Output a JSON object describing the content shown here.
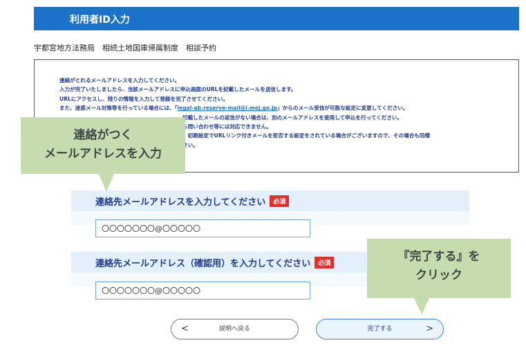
{
  "header": {
    "title": "利用者ID入力"
  },
  "breadcrumb": "宇都宮地方法務局　相続土地国庫帰属制度　相談予約",
  "notice": {
    "line1": "連絡がとれるメールアドレスを入力してください。",
    "line2": "入力が完了いたしましたら、当該メールアドレスに申込画面のURLを記載したメールを送信します。",
    "line3": "URLにアクセスし、残りの情報を入力して登録を完了させてください。",
    "line4_prefix": "また、迷惑メール対策等を行っている場合には、「",
    "line4_link": "legal-ab.reserve-mail@i.moj.go.jp",
    "line4_suffix": "」からのメール受信が可能な設定に変更してください。",
    "line5": "記載したメールの返信がない場合は、別のメールアドレスを使用して申込を行ってください。",
    "line6": "ら問い合わせ等には対応できません。",
    "line7": "、初期設定でURLリンク付きメールを拒否する設定をされている場合がございますので、その場合も同様",
    "line8": "さい。"
  },
  "callouts": {
    "email_hint_line1": "連絡がつく",
    "email_hint_line2": "メールアドレスを入力",
    "complete_hint_line1": "『完了する』を",
    "complete_hint_line2": "クリック"
  },
  "form": {
    "email_label": "連絡先メールアドレスを入力してください",
    "email_confirm_label": "連絡先メールアドレス（確認用）を入力してください",
    "required_badge": "必須",
    "email_value": "〇〇〇〇〇〇〇@〇〇〇〇〇",
    "email_confirm_value": "〇〇〇〇〇〇〇@〇〇〇〇〇"
  },
  "buttons": {
    "back_label": "説明へ戻る",
    "back_arrow": "<",
    "complete_label": "完了する",
    "complete_arrow": ">"
  },
  "colors": {
    "header_blue": "#1c72c8",
    "required_red": "#e0302a",
    "callout_green": "#c5dcae"
  }
}
